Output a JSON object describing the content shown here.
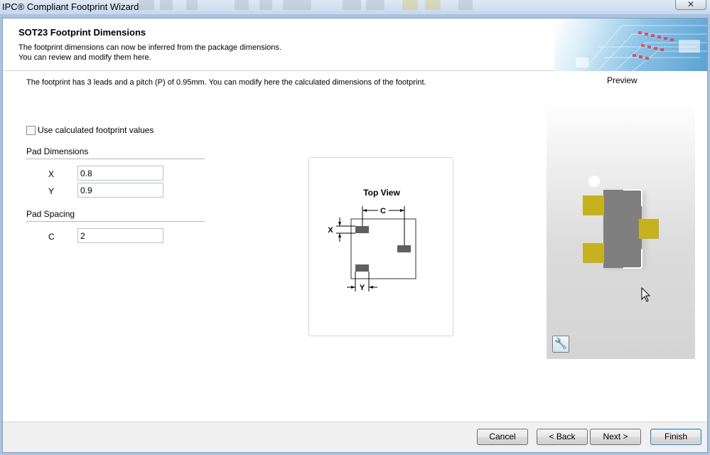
{
  "window": {
    "title": "IPC® Compliant Footprint Wizard",
    "close_glyph": "✕"
  },
  "header": {
    "title": "SOT23 Footprint Dimensions",
    "description": "The footprint dimensions can now be inferred from the package dimensions.\nYou can review and modify them here."
  },
  "main": {
    "intro": "The footprint has 3 leads and a pitch (P) of 0.95mm. You can modify here the calculated dimensions of the footprint.",
    "use_calculated": {
      "label": "Use calculated footprint values",
      "checked": false
    },
    "pad_dimensions": {
      "heading": "Pad Dimensions",
      "x_label": "X",
      "x_value": "0.8",
      "y_label": "Y",
      "y_value": "0.9"
    },
    "pad_spacing": {
      "heading": "Pad Spacing",
      "c_label": "C",
      "c_value": "2"
    },
    "diagram": {
      "title": "Top View",
      "c_label": "C",
      "x_label": "X",
      "y_label": "Y"
    },
    "preview": {
      "label": "Preview",
      "tool_icon": "wrench-icon",
      "pad_color": "#c6b11f",
      "body_color": "#7f7f7f"
    }
  },
  "footer": {
    "cancel": "Cancel",
    "back": "< Back",
    "next": "Next >",
    "finish": "Finish"
  }
}
